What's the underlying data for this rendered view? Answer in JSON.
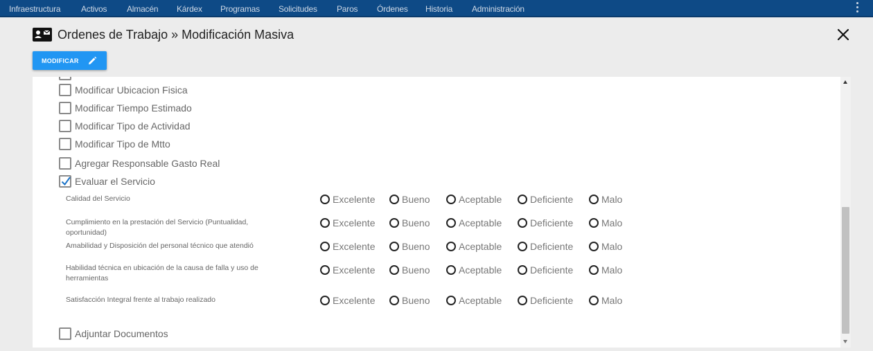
{
  "nav": {
    "items": [
      "Infraestructura",
      "Activos",
      "Almacén",
      "Kárdex",
      "Programas",
      "Solicitudes",
      "Paros",
      "Órdenes",
      "Historia",
      "Administración"
    ]
  },
  "header": {
    "title": "Ordenes de Trabajo » Modificación Masiva",
    "modify_button": "MODIFICAR"
  },
  "options": [
    {
      "label": "Modificar Ubicacion Fisica",
      "checked": false
    },
    {
      "label": "Modificar Tiempo Estimado",
      "checked": false
    },
    {
      "label": "Modificar Tipo de Actividad",
      "checked": false
    },
    {
      "label": "Modificar Tipo de Mtto",
      "checked": false
    },
    {
      "label": "Agregar Responsable Gasto Real",
      "checked": false
    },
    {
      "label": "Evaluar el Servicio",
      "checked": true
    }
  ],
  "evaluation": {
    "ratings": [
      "Excelente",
      "Bueno",
      "Aceptable",
      "Deficiente",
      "Malo"
    ],
    "questions": [
      "Calidad del Servicio",
      "Cumplimiento en la prestación del Servicio (Puntualidad, oportunidad)",
      "Amabilidad y Disposición del personal técnico que atendió",
      "Habilidad técnica en ubicación de la causa de falla y uso de herramientas",
      "Satisfacción Integral frente al trabajo realizado"
    ]
  },
  "attach": {
    "label": "Adjuntar Documentos",
    "checked": false
  },
  "scrollbar": {
    "position_fraction": 0.55
  }
}
